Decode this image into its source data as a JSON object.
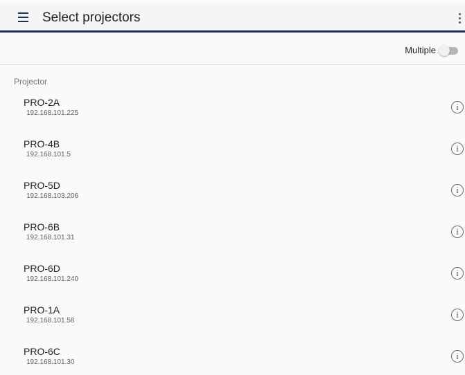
{
  "header": {
    "title": "Select projectors",
    "menu_icon": "hamburger-menu-icon",
    "overflow_icon": "more-vertical-icon",
    "accent_color": "#1d2b5e"
  },
  "toolbar": {
    "multiple_label": "Multiple",
    "multiple_enabled": false
  },
  "section": {
    "label": "Projector"
  },
  "projectors": [
    {
      "name": "PRO-2A",
      "ip": "192.168.101.225",
      "info_glyph": "i"
    },
    {
      "name": "PRO-4B",
      "ip": "192.168.101.5",
      "info_glyph": "i"
    },
    {
      "name": "PRO-5D",
      "ip": "192.168.103.206",
      "info_glyph": "i"
    },
    {
      "name": "PRO-6B",
      "ip": "192.168.101.31",
      "info_glyph": "i"
    },
    {
      "name": "PRO-6D",
      "ip": "192.168.101.240",
      "info_glyph": "i"
    },
    {
      "name": "PRO-1A",
      "ip": "192.168.101.58",
      "info_glyph": "i"
    },
    {
      "name": "PRO-6C",
      "ip": "192.168.101.30",
      "info_glyph": "i"
    }
  ]
}
